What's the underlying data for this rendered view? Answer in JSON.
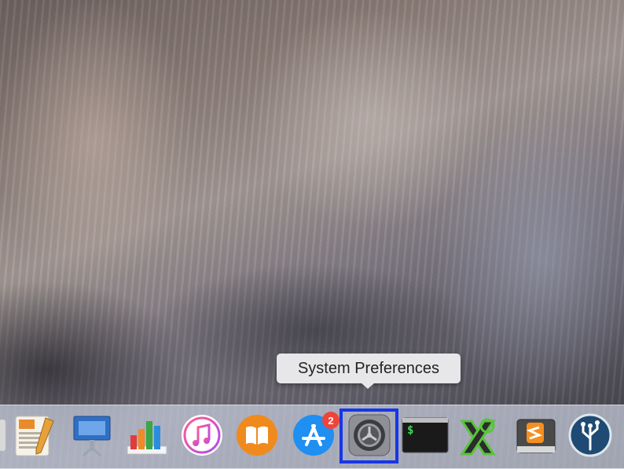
{
  "tooltip": {
    "text": "System Preferences"
  },
  "dock": {
    "items": [
      {
        "name": "pages",
        "icon": "pages-icon"
      },
      {
        "name": "keynote",
        "icon": "keynote-icon"
      },
      {
        "name": "numbers",
        "icon": "numbers-icon"
      },
      {
        "name": "itunes",
        "icon": "itunes-icon"
      },
      {
        "name": "ibooks",
        "icon": "ibooks-icon"
      },
      {
        "name": "app-store",
        "icon": "app-store-icon",
        "badge": "2"
      },
      {
        "name": "system-preferences",
        "icon": "gear-icon",
        "highlighted": true
      },
      {
        "name": "terminal",
        "icon": "terminal-icon",
        "label": "$"
      },
      {
        "name": "xquartz",
        "icon": "xquartz-icon"
      },
      {
        "name": "sublime-text",
        "icon": "sublime-text-icon"
      },
      {
        "name": "sourcetree",
        "icon": "sourcetree-icon"
      }
    ]
  },
  "colors": {
    "highlight": "#1736e6",
    "badge": "#f0443a",
    "dock": "#c8cddc"
  }
}
